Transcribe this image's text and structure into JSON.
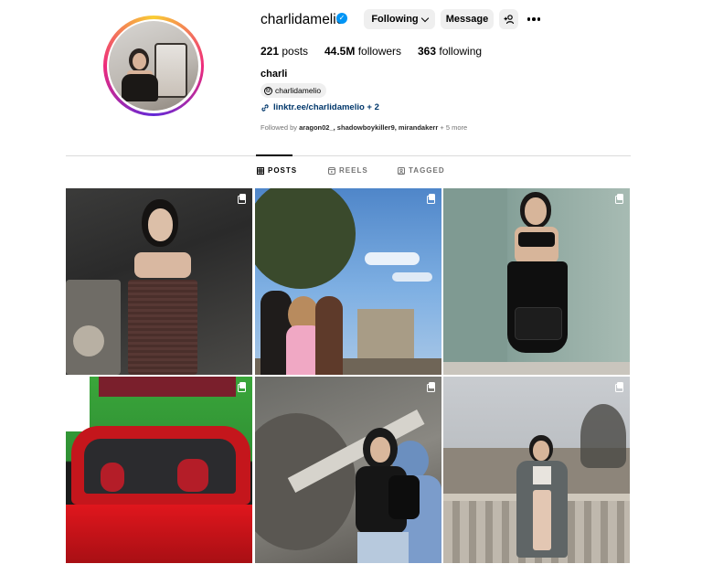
{
  "profile": {
    "username": "charlidamelio",
    "verified_glyph": "✓",
    "following_label": "Following",
    "message_label": "Message",
    "suggest_icon": "+",
    "stats": {
      "posts_count": "221",
      "posts_label": "posts",
      "followers_count": "44.5M",
      "followers_label": "followers",
      "following_count": "363",
      "following_label": "following"
    },
    "display_name": "charli",
    "threads_handle": "charlidamelio",
    "link_text": "linktr.ee/charlidamelio + 2",
    "followed_by_prefix": "Followed by",
    "followed_by_names": "aragon02_, shadowboykiller9, mirandakerr",
    "followed_by_more": "+ 5 more"
  },
  "tabs": [
    {
      "label": "POSTS",
      "icon": "grid-icon",
      "active": true
    },
    {
      "label": "REELS",
      "icon": "reels-icon",
      "active": false
    },
    {
      "label": "TAGGED",
      "icon": "tagged-icon",
      "active": false
    }
  ],
  "posts": [
    {
      "icon": "multiple-photos-icon"
    },
    {
      "icon": "multiple-photos-icon"
    },
    {
      "icon": "multiple-photos-icon"
    },
    {
      "icon": "multiple-photos-icon"
    },
    {
      "icon": "multiple-photos-icon"
    },
    {
      "icon": "multiple-photos-icon"
    }
  ],
  "colors": {
    "accent_blue": "#0095f6",
    "link_blue": "#00376b",
    "button_gray": "#efefef",
    "muted_text": "#737373",
    "divider": "#dbdbdb"
  }
}
